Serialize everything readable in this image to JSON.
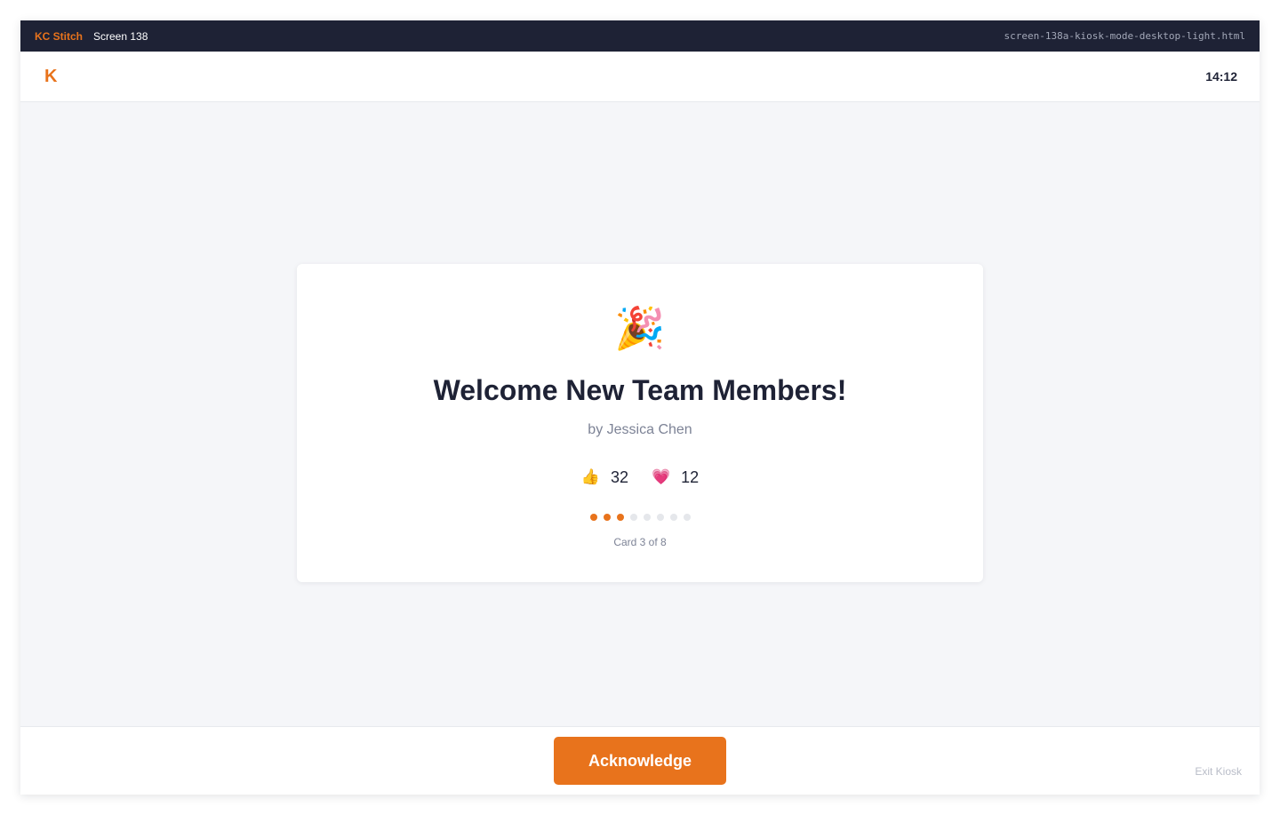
{
  "topbar": {
    "brand": "KC Stitch",
    "screen_label": "Screen 138",
    "filename": "screen-138a-kiosk-mode-desktop-light.html"
  },
  "header": {
    "logo": "K",
    "time": "14:12"
  },
  "card": {
    "emoji": "🎉",
    "emoji_name": "party-popper-icon",
    "title": "Welcome New Team Members!",
    "author": "by Jessica Chen",
    "reactions": [
      {
        "icon": "👍",
        "icon_name": "thumbs-up-icon",
        "count": "32"
      },
      {
        "icon": "💗",
        "icon_name": "heart-icon",
        "count": "12"
      }
    ],
    "pagination": {
      "current": 3,
      "total": 8
    },
    "counter_text": "Card 3 of 8"
  },
  "footer": {
    "acknowledge_label": "Acknowledge",
    "exit_label": "Exit Kiosk"
  },
  "colors": {
    "accent": "#e8731c",
    "topbar_bg": "#1e2235",
    "stage_bg": "#f5f6f9",
    "dot_inactive": "#e5e7eb"
  }
}
